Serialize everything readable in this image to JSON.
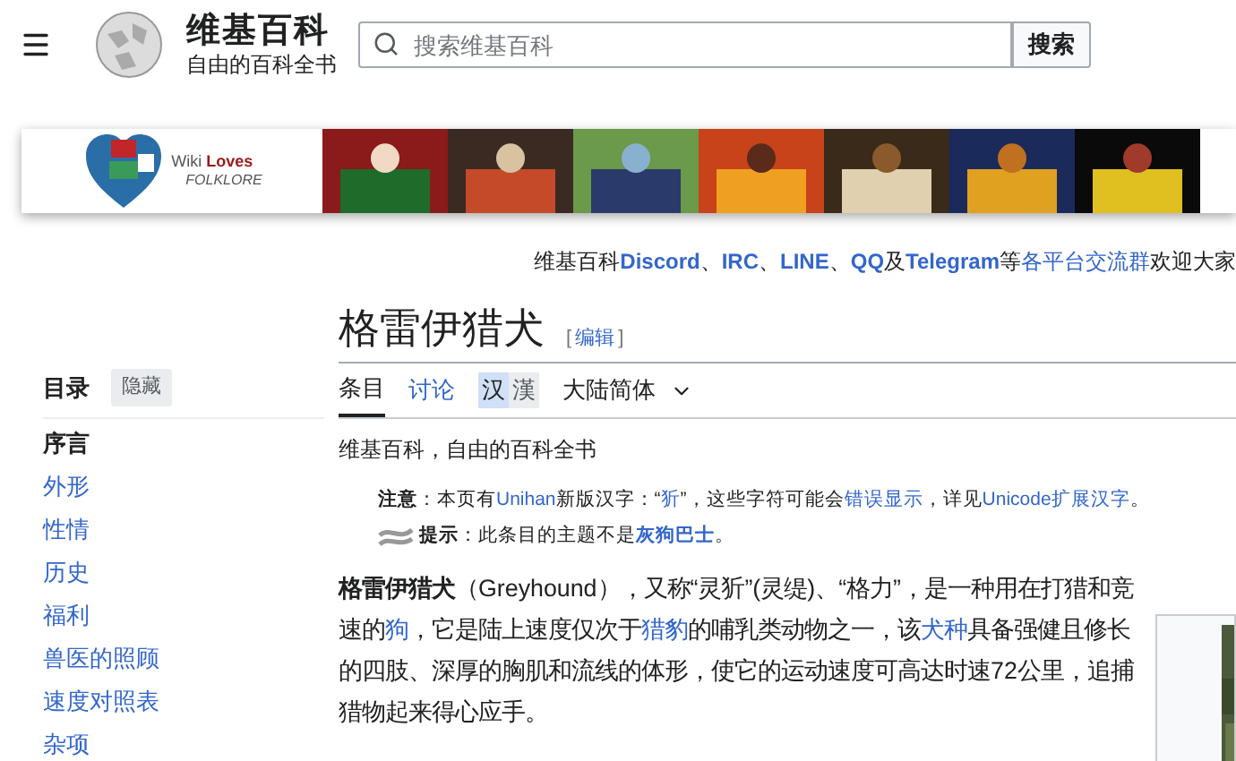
{
  "header": {
    "site_name": "维基百科",
    "tagline": "自由的百科全书",
    "search": {
      "placeholder": "搜索维基百科"
    },
    "search_button": "搜索"
  },
  "banner": {
    "line1_a": "Wiki ",
    "line1_b": "Loves",
    "line2": "FOLKLORE"
  },
  "sitenotice": [
    {
      "kind": "text",
      "text": "维基百科"
    },
    {
      "kind": "bold_link",
      "text": "Discord"
    },
    {
      "kind": "text",
      "text": "、"
    },
    {
      "kind": "bold_link",
      "text": "IRC"
    },
    {
      "kind": "text",
      "text": "、"
    },
    {
      "kind": "bold_link",
      "text": "LINE"
    },
    {
      "kind": "text",
      "text": "、"
    },
    {
      "kind": "bold_link",
      "text": "QQ"
    },
    {
      "kind": "text",
      "text": "及"
    },
    {
      "kind": "bold_link",
      "text": "Telegram"
    },
    {
      "kind": "text",
      "text": "等"
    },
    {
      "kind": "link",
      "text": "各平台交流群"
    },
    {
      "kind": "text",
      "text": "欢迎大家"
    }
  ],
  "toc": {
    "title": "目录",
    "hide_button": "隐藏",
    "items": [
      {
        "label": "序言",
        "selected": true
      },
      {
        "label": "外形",
        "selected": false
      },
      {
        "label": "性情",
        "selected": false
      },
      {
        "label": "历史",
        "selected": false
      },
      {
        "label": "福利",
        "selected": false
      },
      {
        "label": "兽医的照顾",
        "selected": false
      },
      {
        "label": "速度对照表",
        "selected": false
      },
      {
        "label": "杂项",
        "selected": false
      }
    ]
  },
  "article": {
    "title": "格雷伊猎犬",
    "edit_open": "[",
    "edit_link": "编辑",
    "edit_close": "]",
    "tabs": [
      {
        "label": "条目",
        "selected": true
      },
      {
        "label": "讨论",
        "selected": false
      }
    ],
    "script_toggle": [
      {
        "label": "汉",
        "selected": true
      },
      {
        "label": "漢",
        "selected": false
      }
    ],
    "variant": "大陆简体",
    "tagline": "维基百科，自由的百科全书",
    "notes": [
      {
        "kind": "notice",
        "segments": [
          {
            "kind": "bold",
            "text": "注意"
          },
          {
            "kind": "text",
            "text": "：本页有"
          },
          {
            "kind": "link",
            "text": "Unihan"
          },
          {
            "kind": "text",
            "text": "新版汉字：“"
          },
          {
            "kind": "link",
            "text": "㹞"
          },
          {
            "kind": "text",
            "text": "”，这些字符可能会"
          },
          {
            "kind": "link",
            "text": "错误显示"
          },
          {
            "kind": "text",
            "text": "，详见"
          },
          {
            "kind": "link",
            "text": "Unicode扩展汉字"
          },
          {
            "kind": "text",
            "text": "。"
          }
        ]
      },
      {
        "kind": "hatnote",
        "segments": [
          {
            "kind": "bold",
            "text": "提示"
          },
          {
            "kind": "text",
            "text": "：此条目的主题不是"
          },
          {
            "kind": "bold_link",
            "text": "灰狗巴士"
          },
          {
            "kind": "text",
            "text": "。"
          }
        ]
      }
    ],
    "lead": [
      {
        "kind": "bold",
        "text": "格雷伊猎犬"
      },
      {
        "kind": "text",
        "text": "（Greyhound），又称“灵㹞”(灵缇)、“格力”，是一种用在打猎和竞速的"
      },
      {
        "kind": "link",
        "text": "狗"
      },
      {
        "kind": "text",
        "text": "，它是陆上速度仅次于"
      },
      {
        "kind": "link",
        "text": "猎豹"
      },
      {
        "kind": "text",
        "text": "的哺乳类动物之一，该"
      },
      {
        "kind": "link",
        "text": "犬种"
      },
      {
        "kind": "text",
        "text": "具备强健且修长的四肢、深厚的胸肌和流线的体形，使它的运动速度可高达时速72公里，追捕猎物起来得心应手。"
      }
    ]
  }
}
